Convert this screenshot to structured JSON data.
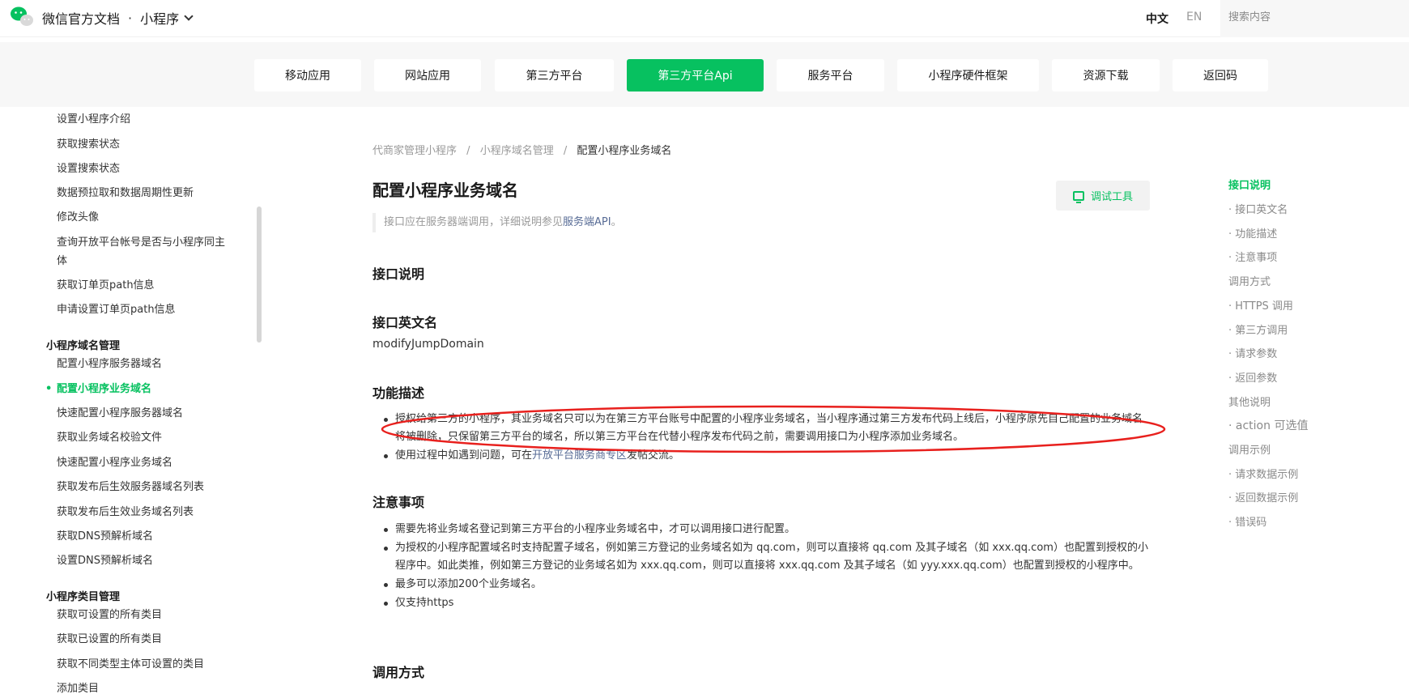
{
  "header": {
    "brand": "微信官方文档",
    "separator": "·",
    "product": "小程序",
    "lang_zh": "中文",
    "lang_en": "EN",
    "search_placeholder": "搜索内容"
  },
  "catnav": {
    "items": [
      "移动应用",
      "网站应用",
      "第三方平台",
      "第三方平台Api",
      "服务平台",
      "小程序硬件框架",
      "资源下载",
      "返回码"
    ],
    "active_index": 3
  },
  "sidebar": {
    "items_top": [
      "设置小程序介绍",
      "获取搜索状态",
      "设置搜索状态",
      "数据预拉取和数据周期性更新",
      "修改头像",
      "查询开放平台帐号是否与小程序同主体",
      "获取订单页path信息",
      "申请设置订单页path信息"
    ],
    "group1": "小程序域名管理",
    "group1_items": [
      "配置小程序服务器域名",
      "配置小程序业务域名",
      "快速配置小程序服务器域名",
      "获取业务域名校验文件",
      "快速配置小程序业务域名",
      "获取发布后生效服务器域名列表",
      "获取发布后生效业务域名列表",
      "获取DNS预解析域名",
      "设置DNS预解析域名"
    ],
    "group2": "小程序类目管理",
    "group2_items": [
      "获取可设置的所有类目",
      "获取已设置的所有类目",
      "获取不同类型主体可设置的类目",
      "添加类目"
    ]
  },
  "breadcrumb": {
    "items": [
      "代商家管理小程序",
      "小程序域名管理",
      "配置小程序业务域名"
    ],
    "separator": "/"
  },
  "article": {
    "title": "配置小程序业务域名",
    "tool_button": "调试工具",
    "note_text": "接口应在服务器端调用，详细说明参见",
    "note_link": "服务端API",
    "note_end": "。",
    "sec_interface": "接口说明",
    "sec_en_name": "接口英文名",
    "en_name": "modifyJumpDomain",
    "sec_desc": "功能描述",
    "desc_items": [
      "授权给第三方的小程序，其业务域名只可以为在第三方平台账号中配置的小程序业务域名，当小程序通过第三方发布代码上线后，小程序原先自己配置的业务域名将被删除，只保留第三方平台的域名，所以第三方平台在代替小程序发布代码之前，需要调用接口为小程序添加业务域名。",
      "使用过程中如遇到问题，可在"
    ],
    "desc_link": "开放平台服务商专区",
    "desc_link_after": "发帖交流。",
    "sec_notes": "注意事项",
    "notes_items": [
      "需要先将业务域名登记到第三方平台的小程序业务域名中，才可以调用接口进行配置。",
      "为授权的小程序配置域名时支持配置子域名，例如第三方登记的业务域名如为 qq.com，则可以直接将 qq.com 及其子域名（如 xxx.qq.com）也配置到授权的小程序中。如此类推，例如第三方登记的业务域名如为 xxx.qq.com，则可以直接将 xxx.qq.com 及其子域名（如 yyy.xxx.qq.com）也配置到授权的小程序中。",
      "最多可以添加200个业务域名。",
      "仅支持https"
    ],
    "sec_call": "调用方式"
  },
  "toc": {
    "items": [
      "接口说明",
      "· 接口英文名",
      "· 功能描述",
      "· 注意事项",
      "调用方式",
      "· HTTPS 调用",
      "· 第三方调用",
      "· 请求参数",
      "· 返回参数",
      "其他说明",
      "· action 可选值",
      "调用示例",
      "· 请求数据示例",
      "· 返回数据示例",
      "· 错误码"
    ],
    "active_index": 0
  },
  "colors": {
    "accent": "#07c160",
    "link": "#576b95",
    "annotation": "#e8201d"
  }
}
